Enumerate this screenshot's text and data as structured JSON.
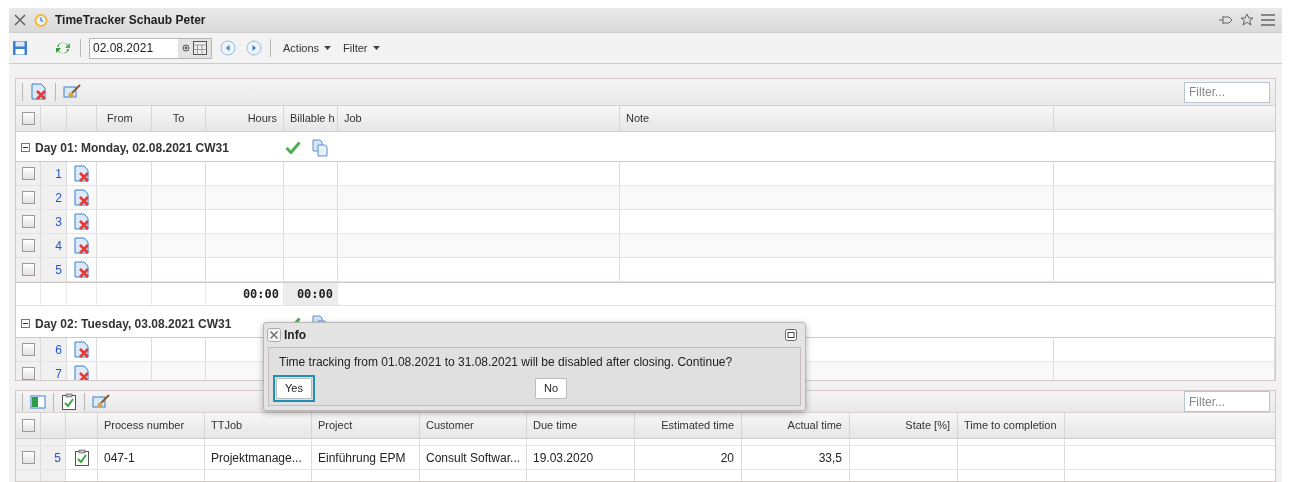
{
  "window": {
    "title": "TimeTracker Schaub Peter"
  },
  "toolbar": {
    "date_value": "02.08.2021",
    "menus": [
      "Actions",
      "Filter"
    ]
  },
  "upper_grid": {
    "filter_placeholder": "Filter...",
    "header_checked": false,
    "columns": [
      "From",
      "To",
      "Hours",
      "Billable h",
      "Job",
      "Note"
    ],
    "days": [
      {
        "title": "Day 01: Monday, 02.08.2021 CW31",
        "expanded": true,
        "rows": [
          {
            "number": "1",
            "checked": false
          },
          {
            "number": "2",
            "checked": false
          },
          {
            "number": "3",
            "checked": false
          },
          {
            "number": "4",
            "checked": false
          },
          {
            "number": "5",
            "checked": false
          }
        ],
        "totals": {
          "hours": "00:00",
          "billable": "00:00"
        }
      },
      {
        "title": "Day 02: Tuesday, 03.08.2021 CW31",
        "expanded": true,
        "rows": [
          {
            "number": "6",
            "checked": false
          },
          {
            "number": "7",
            "checked": false
          }
        ]
      }
    ]
  },
  "lower_grid": {
    "filter_placeholder": "Filter...",
    "header_checked": false,
    "columns": [
      "Process number",
      "TTJob",
      "Project",
      "Customer",
      "Due time",
      "Estimated time",
      "Actual time",
      "State [%]",
      "Time to completion"
    ],
    "rows": [
      {
        "number": "5",
        "checked": false,
        "cells": [
          "047-1",
          "Projektmanage...",
          "Einführung EPM",
          "Consult Softwar...",
          "19.03.2020",
          "20",
          "33,5"
        ]
      }
    ]
  },
  "dialog": {
    "title": "Info",
    "message": "Time tracking from 01.08.2021 to 31.08.2021 will be disabled after closing. Continue?",
    "buttons": [
      {
        "label": "Yes",
        "focused": true
      },
      {
        "label": "No",
        "focused": false
      }
    ]
  }
}
